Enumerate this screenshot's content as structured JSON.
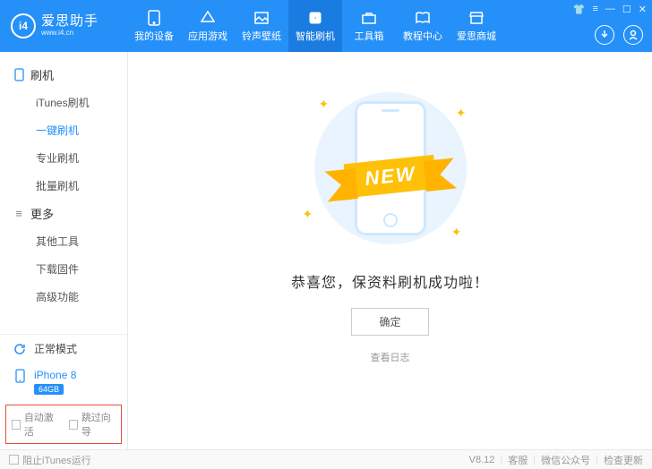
{
  "logo": {
    "glyph": "i4",
    "title": "爱思助手",
    "url": "www.i4.cn"
  },
  "nav": [
    {
      "label": "我的设备"
    },
    {
      "label": "应用游戏"
    },
    {
      "label": "铃声壁纸"
    },
    {
      "label": "智能刷机",
      "active": true
    },
    {
      "label": "工具箱"
    },
    {
      "label": "教程中心"
    },
    {
      "label": "爱思商城"
    }
  ],
  "sidebar": {
    "sections": [
      {
        "title": "刷机",
        "items": [
          "iTunes刷机",
          "一键刷机",
          "专业刷机",
          "批量刷机"
        ],
        "activeIndex": 1
      },
      {
        "title": "更多",
        "items": [
          "其他工具",
          "下载固件",
          "高级功能"
        ]
      }
    ],
    "mode": "正常模式",
    "device": {
      "name": "iPhone 8",
      "storage": "64GB"
    },
    "options": {
      "autoActivate": "自动激活",
      "skipGuide": "跳过向导"
    }
  },
  "main": {
    "ribbon": "NEW",
    "message": "恭喜您，保资料刷机成功啦！",
    "okButton": "确定",
    "viewLog": "查看日志"
  },
  "footer": {
    "blockItunes": "阻止iTunes运行",
    "version": "V8.12",
    "links": [
      "客服",
      "微信公众号",
      "检查更新"
    ]
  }
}
